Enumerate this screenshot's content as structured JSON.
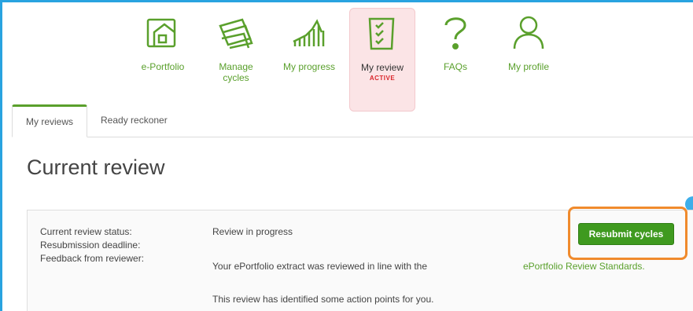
{
  "nav": {
    "items": [
      {
        "label": "e-Portfolio",
        "icon": "portfolio-icon"
      },
      {
        "label": "Manage cycles",
        "icon": "cycles-icon"
      },
      {
        "label": "My progress",
        "icon": "progress-chart-icon"
      },
      {
        "label": "My review",
        "icon": "checklist-icon",
        "badge": "ACTIVE"
      },
      {
        "label": "FAQs",
        "icon": "question-icon"
      },
      {
        "label": "My profile",
        "icon": "person-icon"
      }
    ]
  },
  "tabs": [
    {
      "label": "My reviews"
    },
    {
      "label": "Ready reckoner"
    }
  ],
  "page_title": "Current review",
  "review": {
    "status_label": "Current review status:",
    "deadline_label": "Resubmission deadline:",
    "feedback_label": "Feedback from reviewer:",
    "status_value": "Review in progress",
    "feedback_value": "Your ePortfolio extract was reviewed in line with the",
    "standards_link": "ePortfolio Review Standards.",
    "action_points": "This review has identified some action points for you.",
    "resubmit_label": "Resubmit cycles"
  },
  "colors": {
    "accent": "#5aa02c",
    "button": "#3f9a1f",
    "highlight": "#f08a2c",
    "frame": "#29a3e0"
  }
}
